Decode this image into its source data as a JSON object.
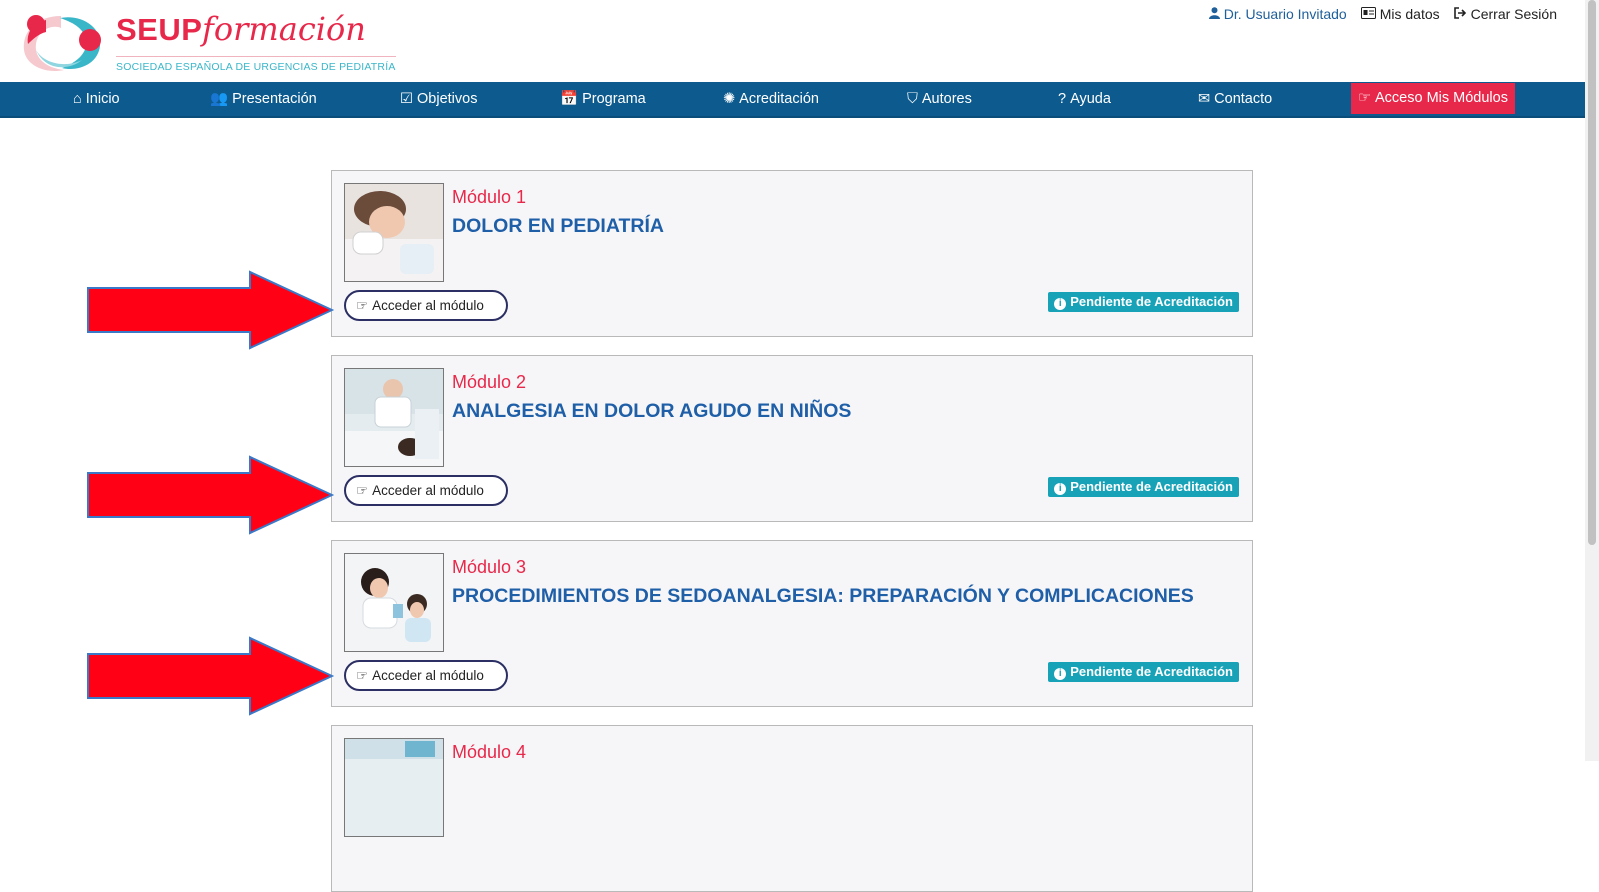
{
  "header": {
    "logo_title": "SEUP",
    "logo_subtitle": "formación",
    "logo_tagline": "SOCIEDAD ESPAÑOLA DE URGENCIAS DE PEDIATRÍA",
    "user_name": "Dr. Usuario Invitado",
    "my_data": "Mis datos",
    "logout": "Cerrar Sesión"
  },
  "nav": {
    "items": [
      {
        "label": "Inicio",
        "icon": "home-icon"
      },
      {
        "label": "Presentación",
        "icon": "users-icon"
      },
      {
        "label": "Objetivos",
        "icon": "check-square-icon"
      },
      {
        "label": "Programa",
        "icon": "calendar-check-icon"
      },
      {
        "label": "Acreditación",
        "icon": "certificate-icon"
      },
      {
        "label": "Autores",
        "icon": "shield-icon"
      },
      {
        "label": "Ayuda",
        "icon": "question-circle-icon"
      },
      {
        "label": "Contacto",
        "icon": "envelope-icon"
      },
      {
        "label": "Acceso Mis Módulos",
        "icon": "hand-point-right-icon"
      }
    ]
  },
  "modules": [
    {
      "number": "Módulo 1",
      "title": "DOLOR EN PEDIATRÍA",
      "button": "Acceder al módulo",
      "status": "Pendiente de Acreditación"
    },
    {
      "number": "Módulo 2",
      "title": "ANALGESIA EN DOLOR AGUDO EN NIÑOS",
      "button": "Acceder al módulo",
      "status": "Pendiente de Acreditación"
    },
    {
      "number": "Módulo 3",
      "title": "PROCEDIMIENTOS DE SEDOANALGESIA: PREPARACIÓN Y COMPLICACIONES",
      "button": "Acceder al módulo",
      "status": "Pendiente de Acreditación"
    },
    {
      "number": "Módulo 4",
      "title": "",
      "button": "",
      "status": ""
    }
  ],
  "colors": {
    "brand_red": "#e8284a",
    "nav_blue": "#0c5a8e",
    "title_blue": "#1f5fa8",
    "badge_teal": "#17a2b8",
    "arrow_red": "#ff0015"
  }
}
